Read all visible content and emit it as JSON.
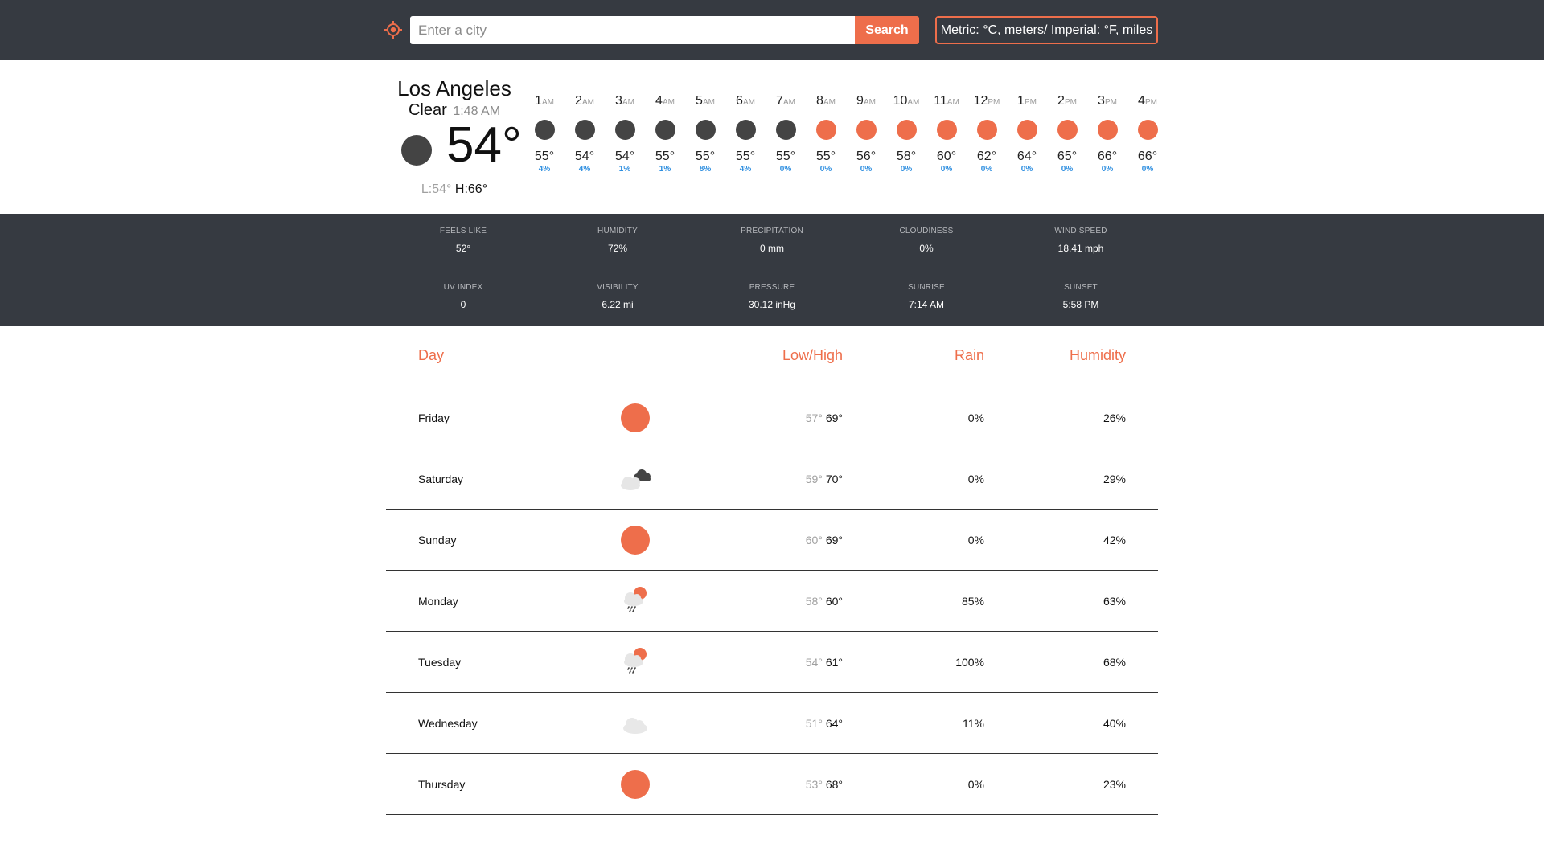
{
  "search": {
    "placeholder": "Enter a city",
    "button_label": "Search",
    "units_label": "Metric: °C, meters/ Imperial: °F, miles"
  },
  "colors": {
    "accent": "#ee6e4b",
    "dark": "#363a41",
    "night_icon": "#444444",
    "precip_blue": "#2f8fe0"
  },
  "current": {
    "city": "Los Angeles",
    "condition": "Clear",
    "time": "1:48 AM",
    "temp": "54°",
    "icon": "moon-icon",
    "low": "L:54°",
    "high": "H:66°"
  },
  "hourly": [
    {
      "hour": "1",
      "ampm": "AM",
      "temp": "55°",
      "pop": "4%",
      "icon": "night"
    },
    {
      "hour": "2",
      "ampm": "AM",
      "temp": "54°",
      "pop": "4%",
      "icon": "night"
    },
    {
      "hour": "3",
      "ampm": "AM",
      "temp": "54°",
      "pop": "1%",
      "icon": "night"
    },
    {
      "hour": "4",
      "ampm": "AM",
      "temp": "55°",
      "pop": "1%",
      "icon": "night"
    },
    {
      "hour": "5",
      "ampm": "AM",
      "temp": "55°",
      "pop": "8%",
      "icon": "night"
    },
    {
      "hour": "6",
      "ampm": "AM",
      "temp": "55°",
      "pop": "4%",
      "icon": "night"
    },
    {
      "hour": "7",
      "ampm": "AM",
      "temp": "55°",
      "pop": "0%",
      "icon": "night"
    },
    {
      "hour": "8",
      "ampm": "AM",
      "temp": "55°",
      "pop": "0%",
      "icon": "sun"
    },
    {
      "hour": "9",
      "ampm": "AM",
      "temp": "56°",
      "pop": "0%",
      "icon": "sun"
    },
    {
      "hour": "10",
      "ampm": "AM",
      "temp": "58°",
      "pop": "0%",
      "icon": "sun"
    },
    {
      "hour": "11",
      "ampm": "AM",
      "temp": "60°",
      "pop": "0%",
      "icon": "sun"
    },
    {
      "hour": "12",
      "ampm": "PM",
      "temp": "62°",
      "pop": "0%",
      "icon": "sun"
    },
    {
      "hour": "1",
      "ampm": "PM",
      "temp": "64°",
      "pop": "0%",
      "icon": "sun"
    },
    {
      "hour": "2",
      "ampm": "PM",
      "temp": "65°",
      "pop": "0%",
      "icon": "sun"
    },
    {
      "hour": "3",
      "ampm": "PM",
      "temp": "66°",
      "pop": "0%",
      "icon": "sun"
    },
    {
      "hour": "4",
      "ampm": "PM",
      "temp": "66°",
      "pop": "0%",
      "icon": "sun"
    }
  ],
  "details": [
    {
      "label": "FEELS LIKE",
      "value": "52°"
    },
    {
      "label": "HUMIDITY",
      "value": "72%"
    },
    {
      "label": "PRECIPITATION",
      "value": "0 mm"
    },
    {
      "label": "CLOUDINESS",
      "value": "0%"
    },
    {
      "label": "WIND SPEED",
      "value": "18.41 mph"
    },
    {
      "label": "UV INDEX",
      "value": "0"
    },
    {
      "label": "VISIBILITY",
      "value": "6.22 mi"
    },
    {
      "label": "PRESSURE",
      "value": "30.12 inHg"
    },
    {
      "label": "SUNRISE",
      "value": "7:14 AM"
    },
    {
      "label": "SUNSET",
      "value": "5:58 PM"
    }
  ],
  "daily_headers": {
    "day": "Day",
    "lowhigh": "Low/High",
    "rain": "Rain",
    "humidity": "Humidity"
  },
  "daily": [
    {
      "day": "Friday",
      "icon": "sun-icon",
      "low": "57°",
      "high": "69°",
      "rain": "0%",
      "humidity": "26%"
    },
    {
      "day": "Saturday",
      "icon": "clouds-icon",
      "low": "59°",
      "high": "70°",
      "rain": "0%",
      "humidity": "29%"
    },
    {
      "day": "Sunday",
      "icon": "sun-icon",
      "low": "60°",
      "high": "69°",
      "rain": "0%",
      "humidity": "42%"
    },
    {
      "day": "Monday",
      "icon": "rain-sun-icon",
      "low": "58°",
      "high": "60°",
      "rain": "85%",
      "humidity": "63%"
    },
    {
      "day": "Tuesday",
      "icon": "rain-sun-icon",
      "low": "54°",
      "high": "61°",
      "rain": "100%",
      "humidity": "68%"
    },
    {
      "day": "Wednesday",
      "icon": "cloud-icon",
      "low": "51°",
      "high": "64°",
      "rain": "11%",
      "humidity": "40%"
    },
    {
      "day": "Thursday",
      "icon": "sun-icon",
      "low": "53°",
      "high": "68°",
      "rain": "0%",
      "humidity": "23%"
    }
  ]
}
